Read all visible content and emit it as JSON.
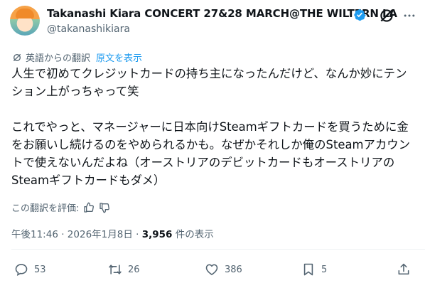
{
  "author": {
    "display_name": "Takanashi Kiara CONCERT 27&28 MARCH@THE WILTERN LA",
    "handle": "@takanashikiara"
  },
  "translation": {
    "label": "英語からの翻訳",
    "show_original": "原文を表示"
  },
  "tweet_text": "人生で初めてクレジットカードの持ち主になったんだけど、なんか妙にテンション上がっちゃって笑\n\nこれでやっと、マネージャーに日本向けSteamギフトカードを買うために金をお願いし続けるのをやめられるかも。なぜかそれしか俺のSteamアカウントで使えないんだよね（オーストリアのデビットカードもオーストリアのSteamギフトカードもダメ）",
  "rate_translation": "この翻訳を評価:",
  "meta": {
    "time": "午後11:46",
    "separator": "·",
    "date": "2026年1月8日",
    "views_count": "3,956",
    "views_label": "件の表示"
  },
  "actions": {
    "replies": "53",
    "reposts": "26",
    "likes": "386",
    "bookmarks": "5"
  },
  "colors": {
    "accent": "#1d9bf0",
    "text": "#0f1419",
    "secondary": "#536471"
  }
}
